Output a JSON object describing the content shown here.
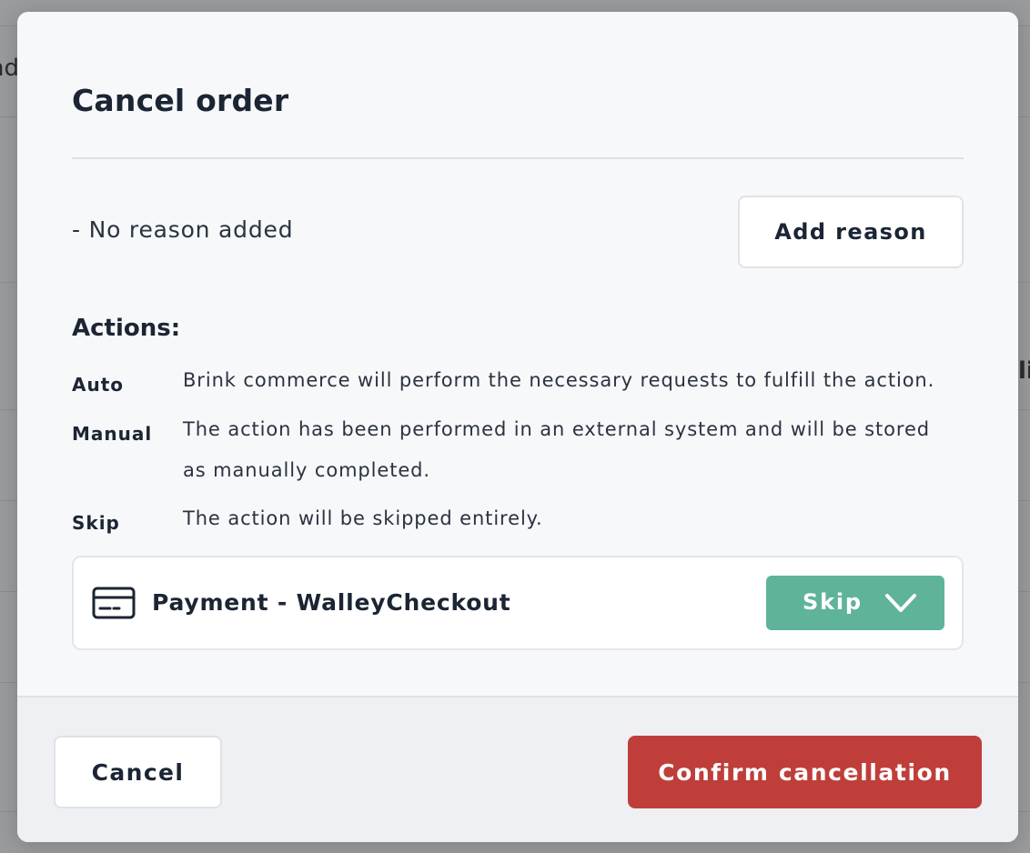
{
  "background": {
    "fragment_top": "nd",
    "fragment_right": "li"
  },
  "modal": {
    "title": "Cancel order",
    "reason": {
      "text": "- No reason added",
      "add_button_label": "Add reason"
    },
    "actions": {
      "heading": "Actions:",
      "items": [
        {
          "key": "Auto",
          "description": "Brink commerce will perform the necessary requests to fulfill the action."
        },
        {
          "key": "Manual",
          "description": "The action has been performed in an external system and will be stored as manually completed."
        },
        {
          "key": "Skip",
          "description": "The action will be skipped entirely."
        }
      ]
    },
    "payment": {
      "label": "Payment - WalleyCheckout",
      "icon": "credit-card-icon",
      "selected_action": "Skip"
    },
    "footer": {
      "cancel_label": "Cancel",
      "confirm_label": "Confirm cancellation"
    }
  },
  "colors": {
    "overlay": "#9a9b9d",
    "modal_bg": "#f7f8fa",
    "select_green": "#5fb39a",
    "confirm_red": "#bf3e3a",
    "text_dark": "#1b2533"
  }
}
